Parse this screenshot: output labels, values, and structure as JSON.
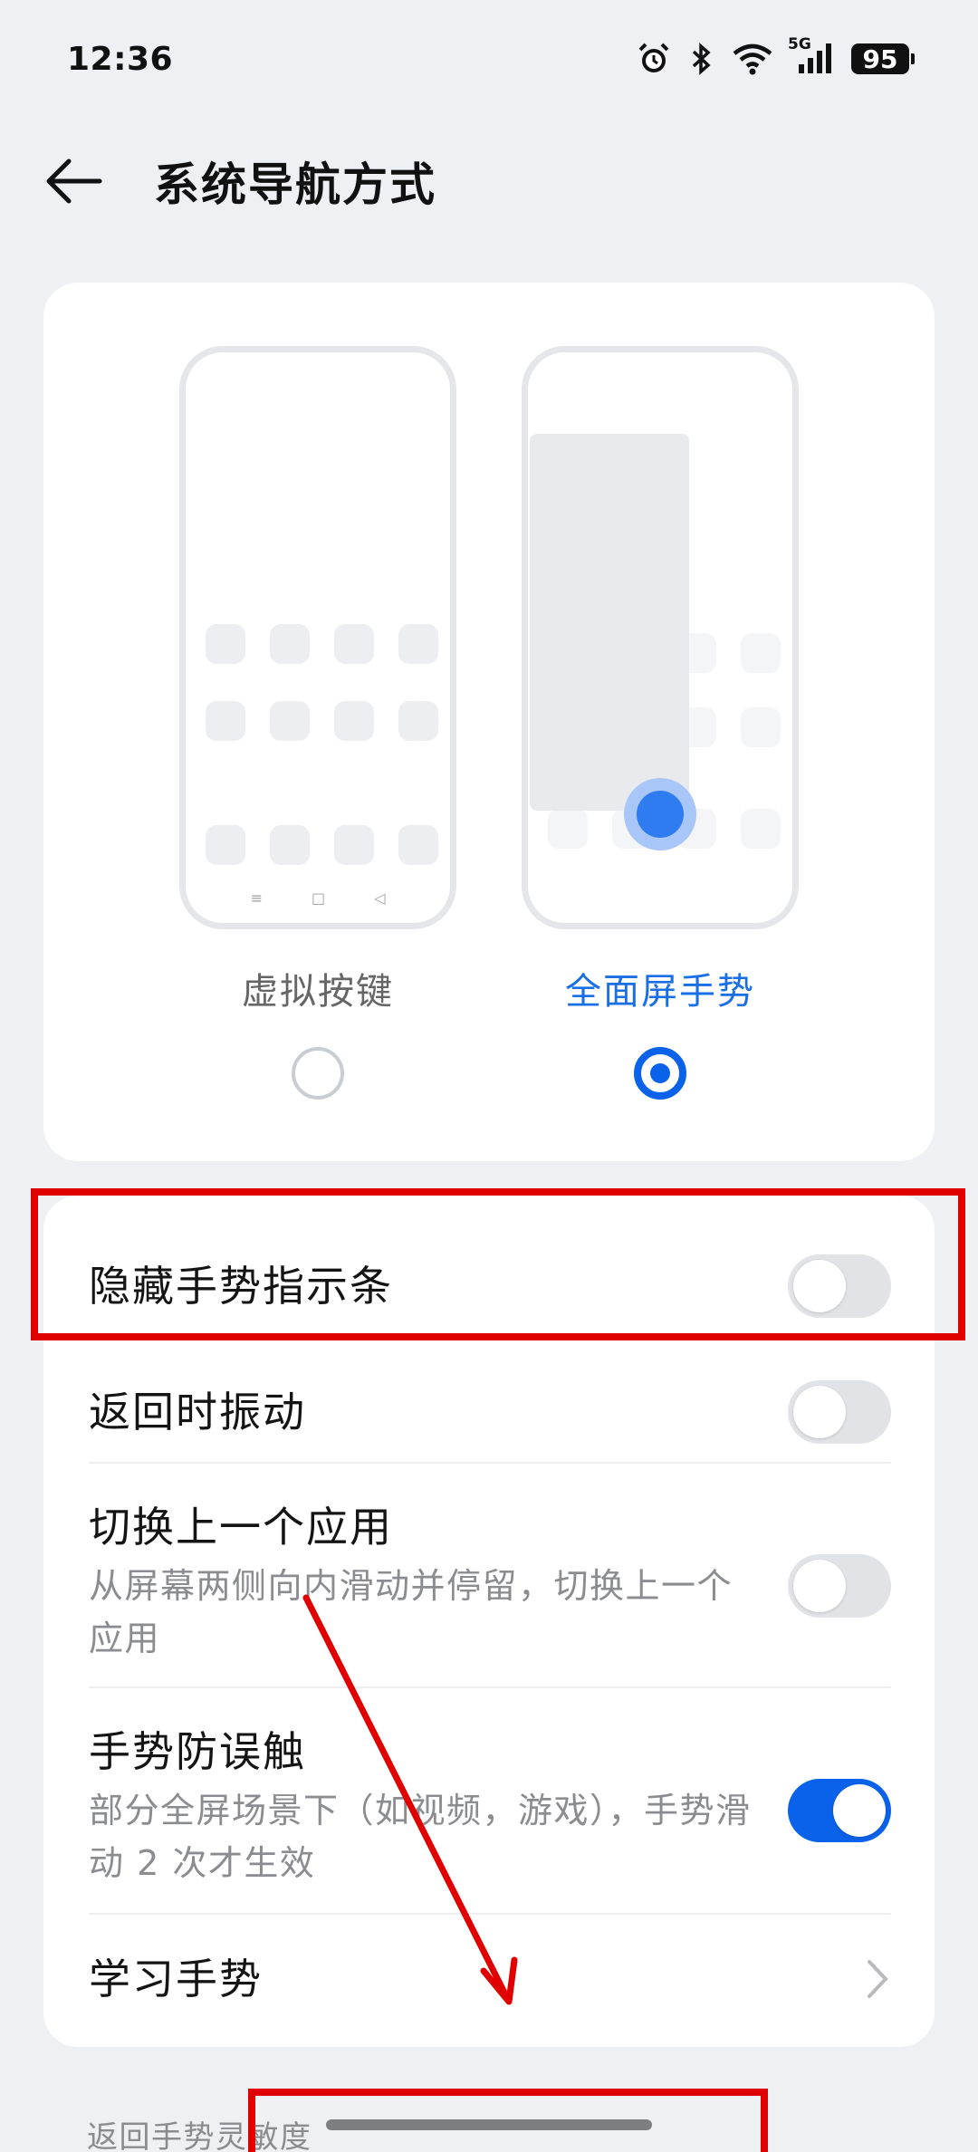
{
  "status_bar": {
    "time": "12:36",
    "network": "5G",
    "battery": "95"
  },
  "header": {
    "title": "系统导航方式"
  },
  "nav_options": [
    {
      "label": "虚拟按键",
      "selected": false
    },
    {
      "label": "全面屏手势",
      "selected": true
    }
  ],
  "settings": {
    "hide_indicator": {
      "title": "隐藏手势指示条",
      "on": false
    },
    "vibrate_on_back": {
      "title": "返回时振动",
      "on": false
    },
    "switch_prev_app": {
      "title": "切换上一个应用",
      "desc": "从屏幕两侧向内滑动并停留，切换上一个应用",
      "on": false
    },
    "gesture_guard": {
      "title": "手势防误触",
      "desc": "部分全屏场景下（如视频，游戏），手势滑动 2 次才生效",
      "on": true
    },
    "learn_gestures": {
      "title": "学习手势"
    }
  },
  "next_section": {
    "label": "返回手势灵敏度"
  },
  "colors": {
    "accent": "#0a62ea",
    "annotation": "#e00000"
  }
}
